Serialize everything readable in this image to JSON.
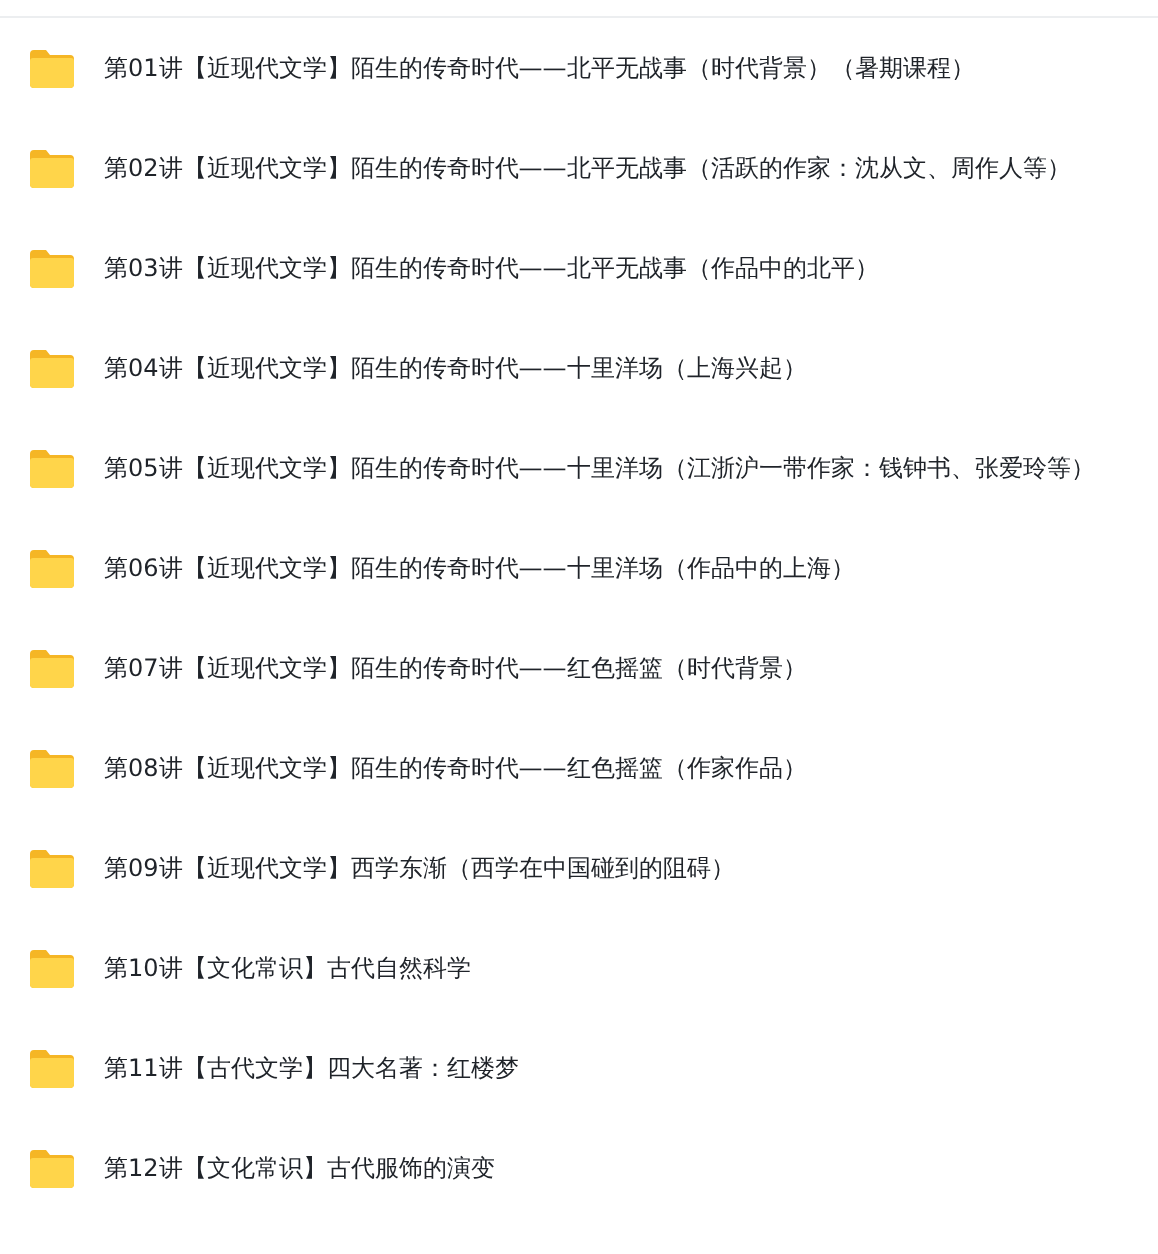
{
  "items": [
    {
      "name": "第01讲【近现代文学】陌生的传奇时代——北平无战事（时代背景）（暑期课程）"
    },
    {
      "name": "第02讲【近现代文学】陌生的传奇时代——北平无战事（活跃的作家：沈从文、周作人等）"
    },
    {
      "name": "第03讲【近现代文学】陌生的传奇时代——北平无战事（作品中的北平）"
    },
    {
      "name": "第04讲【近现代文学】陌生的传奇时代——十里洋场（上海兴起）"
    },
    {
      "name": "第05讲【近现代文学】陌生的传奇时代——十里洋场（江浙沪一带作家：钱钟书、张爱玲等）"
    },
    {
      "name": "第06讲【近现代文学】陌生的传奇时代——十里洋场（作品中的上海）"
    },
    {
      "name": "第07讲【近现代文学】陌生的传奇时代——红色摇篮（时代背景）"
    },
    {
      "name": "第08讲【近现代文学】陌生的传奇时代——红色摇篮（作家作品）"
    },
    {
      "name": "第09讲【近现代文学】西学东渐（西学在中国碰到的阻碍）"
    },
    {
      "name": "第10讲【文化常识】古代自然科学"
    },
    {
      "name": "第11讲【古代文学】四大名著：红楼梦"
    },
    {
      "name": "第12讲【文化常识】古代服饰的演变"
    }
  ]
}
